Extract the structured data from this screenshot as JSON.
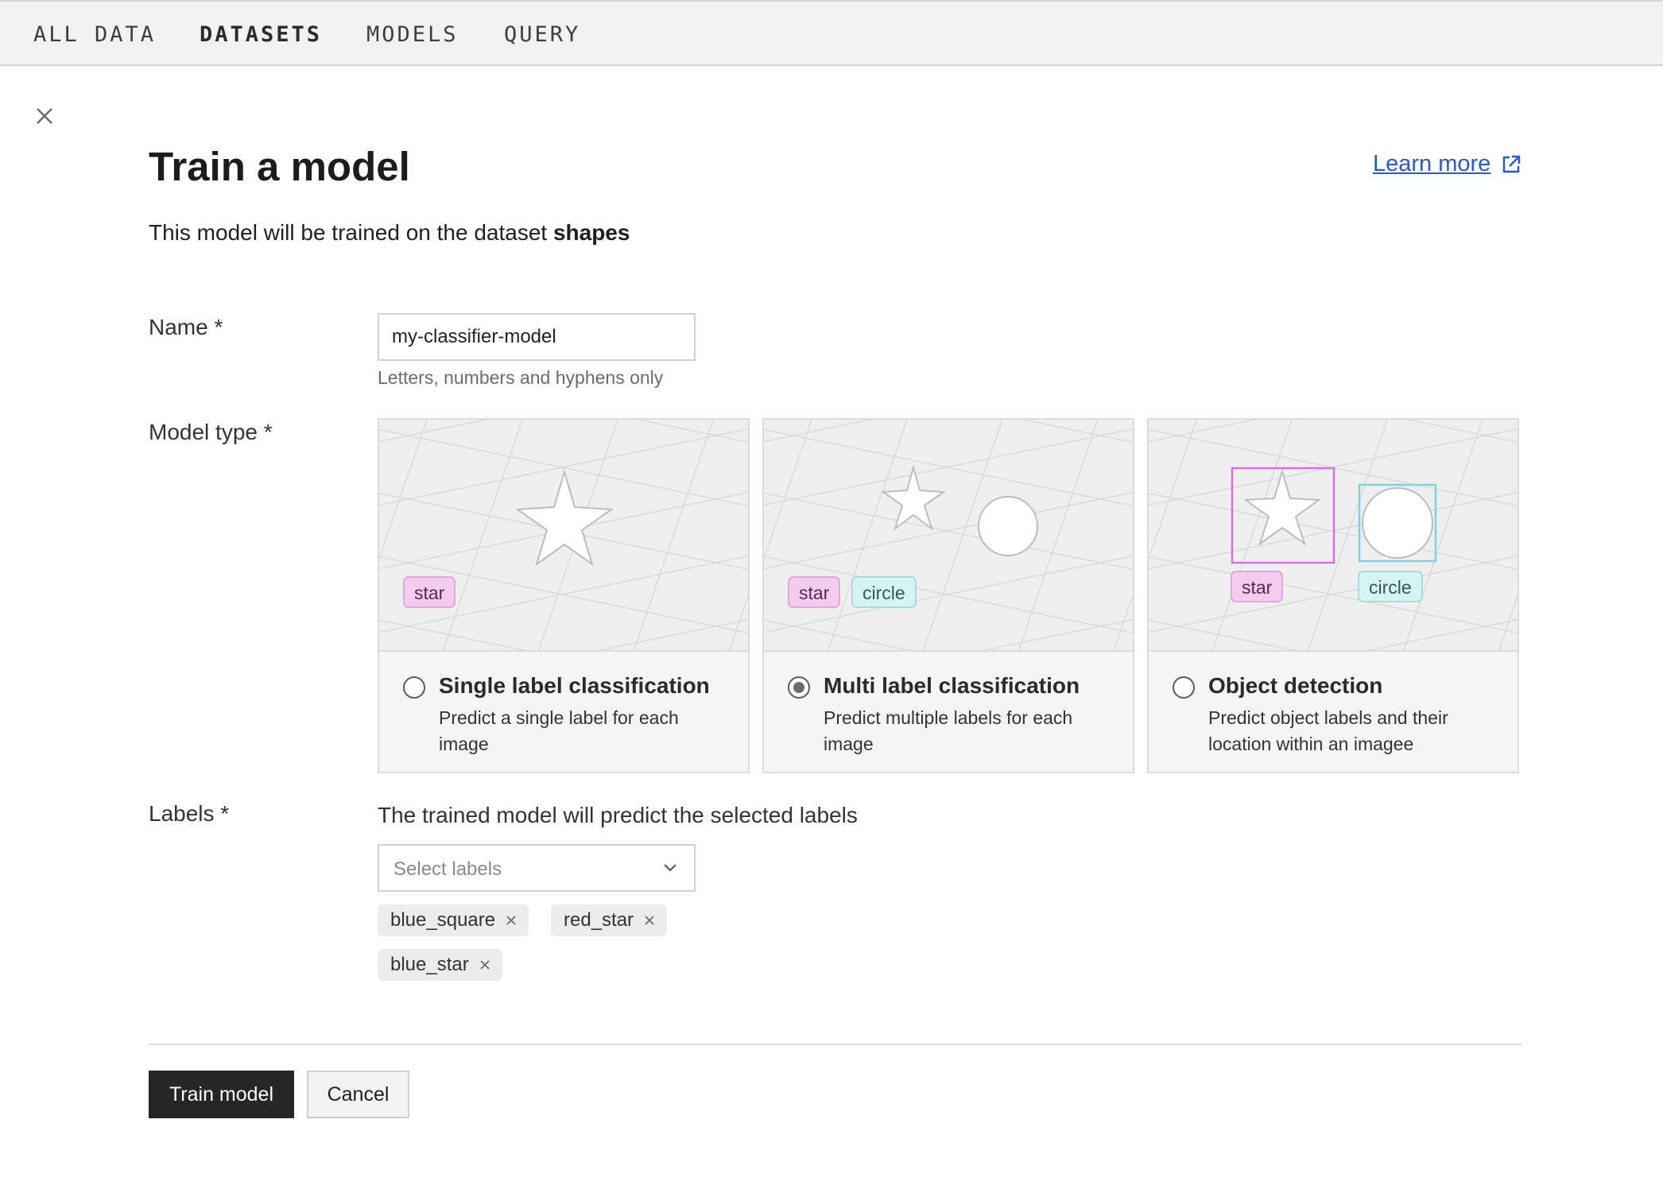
{
  "nav": {
    "tabs": [
      {
        "label": "ALL DATA"
      },
      {
        "label": "DATASETS"
      },
      {
        "label": "MODELS"
      },
      {
        "label": "QUERY"
      }
    ],
    "active_tab": "DATASETS"
  },
  "page": {
    "title": "Train a model",
    "learn_more": "Learn more",
    "subtitle_prefix": "This model will be trained on the dataset ",
    "dataset_name": "shapes"
  },
  "form": {
    "name": {
      "label": "Name *",
      "value": "my-classifier-model",
      "hint": "Letters, numbers and hyphens only"
    },
    "model_type": {
      "label": "Model type *",
      "selected": "Multi label classification",
      "options": [
        {
          "title": "Single label classification",
          "description": "Predict a single label for each image",
          "chips": [
            "star"
          ]
        },
        {
          "title": "Multi label classification",
          "description": "Predict multiple labels for each image",
          "chips": [
            "star",
            "circle"
          ]
        },
        {
          "title": "Object detection",
          "description": "Predict object labels and their location within an imagee",
          "chips": [
            "star",
            "circle"
          ]
        }
      ]
    },
    "labels": {
      "label": "Labels *",
      "description": "The trained model will predict the selected labels",
      "placeholder": "Select labels",
      "selected": [
        "blue_square",
        "red_star",
        "blue_star"
      ]
    }
  },
  "actions": {
    "primary": "Train model",
    "secondary": "Cancel"
  },
  "colors": {
    "primary_button": "#262626",
    "link": "#2b59c3",
    "chip_star": "#f3ccf0",
    "chip_circle": "#d8f3f3",
    "box_star": "#d96fe0",
    "box_circle": "#7fd3df"
  }
}
